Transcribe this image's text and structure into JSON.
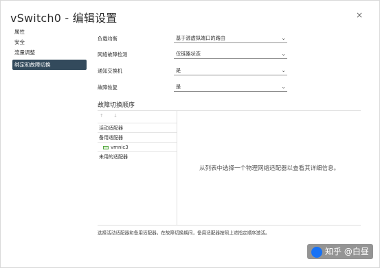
{
  "dialog": {
    "title": "vSwitch0 - 编辑设置",
    "close_label": "×"
  },
  "nav": {
    "items": [
      "属性",
      "安全",
      "流量调整",
      "绑定和故障切换"
    ],
    "active_index": 3
  },
  "settings": [
    {
      "label": "负载均衡",
      "value": "基于源虚拟端口的路由"
    },
    {
      "label": "网络故障检测",
      "value": "仅链路状态"
    },
    {
      "label": "通知交换机",
      "value": "是"
    },
    {
      "label": "故障恢复",
      "value": "是"
    }
  ],
  "failover": {
    "title": "故障切换顺序",
    "arrows": "↑ ↓",
    "rows": [
      {
        "text": "活动适配器",
        "type": "group"
      },
      {
        "text": "备用适配器",
        "type": "group"
      },
      {
        "text": "vmnic3",
        "type": "nic"
      },
      {
        "text": "未用的适配器",
        "type": "group"
      }
    ],
    "hint": "从列表中选择一个物理网络适配器以查看其详细信息。"
  },
  "footer_text": "选择活动适配器和备用适配器。在故障切换期间，备用适配器按照上述指定顺序激活。",
  "watermark": "知乎 @白昼",
  "colors": {
    "nav_active_bg": "#334a5c",
    "nic_icon": "#56a842"
  }
}
